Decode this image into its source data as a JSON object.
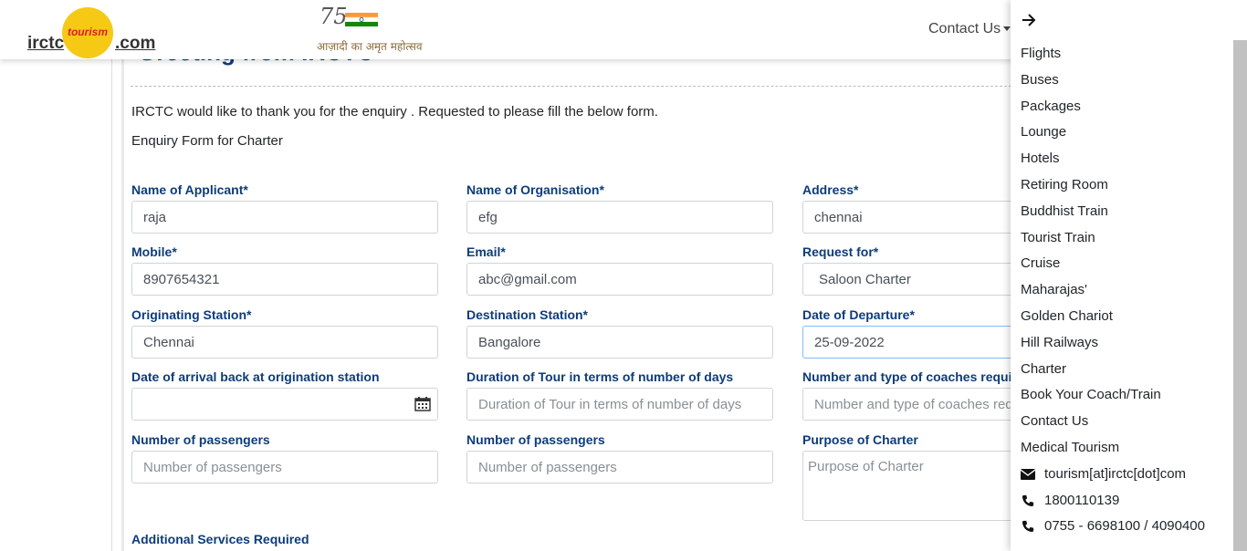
{
  "header": {
    "logo": {
      "left": "irctc",
      "badge": "tourism",
      "right": ".com"
    },
    "azadi_text": "आज़ादी का अमृत महोत्सव",
    "contact_us": "Contact Us"
  },
  "page": {
    "greeting": "Greeting from IRCTC",
    "intro": "IRCTC would like to thank you for the enquiry . Requested to please fill the below form.",
    "form_title": "Enquiry Form for Charter"
  },
  "form": {
    "applicant_label": "Name of Applicant*",
    "applicant_value": "raja",
    "organisation_label": "Name of Organisation*",
    "organisation_value": "efg",
    "address_label": "Address*",
    "address_value": "chennai",
    "mobile_label": "Mobile*",
    "mobile_value": "8907654321",
    "email_label": "Email*",
    "email_value": "abc@gmail.com",
    "request_label": "Request for*",
    "request_value": "Saloon Charter",
    "origin_label": "Originating Station*",
    "origin_value": "Chennai",
    "destination_label": "Destination Station*",
    "destination_value": "Bangalore",
    "departure_label": "Date of Departure*",
    "departure_value": "25-09-2022",
    "arrival_label": "Date of arrival back at origination station",
    "arrival_value": "",
    "duration_label": "Duration of Tour in terms of number of days",
    "duration_placeholder": "Duration of Tour in terms of number of days",
    "coaches_label": "Number and type of coaches required",
    "coaches_placeholder": "Number and type of coaches required",
    "passengers1_label": "Number of passengers",
    "passengers1_placeholder": "Number of passengers",
    "passengers2_label": "Number of passengers",
    "passengers2_placeholder": "Number of passengers",
    "purpose_label": "Purpose of Charter",
    "purpose_placeholder": "Purpose of Charter",
    "additional_label": "Additional Services Required"
  },
  "drawer": {
    "items": [
      "Flights",
      "Buses",
      "Packages",
      "Lounge",
      "Hotels",
      "Retiring Room",
      "Buddhist Train",
      "Tourist Train",
      "Cruise",
      "Maharajas'",
      "Golden Chariot",
      "Hill Railways",
      "Charter",
      "Book Your Coach/Train",
      "Contact Us",
      "Medical Tourism"
    ],
    "email": "tourism[at]irctc[dot]com",
    "phone1": "1800110139",
    "phone2": "0755 - 6698100 / 4090400"
  },
  "colors": {
    "label_blue": "#0d3c7a",
    "logo_yellow": "#f6c915",
    "logo_red": "#d91f26"
  }
}
